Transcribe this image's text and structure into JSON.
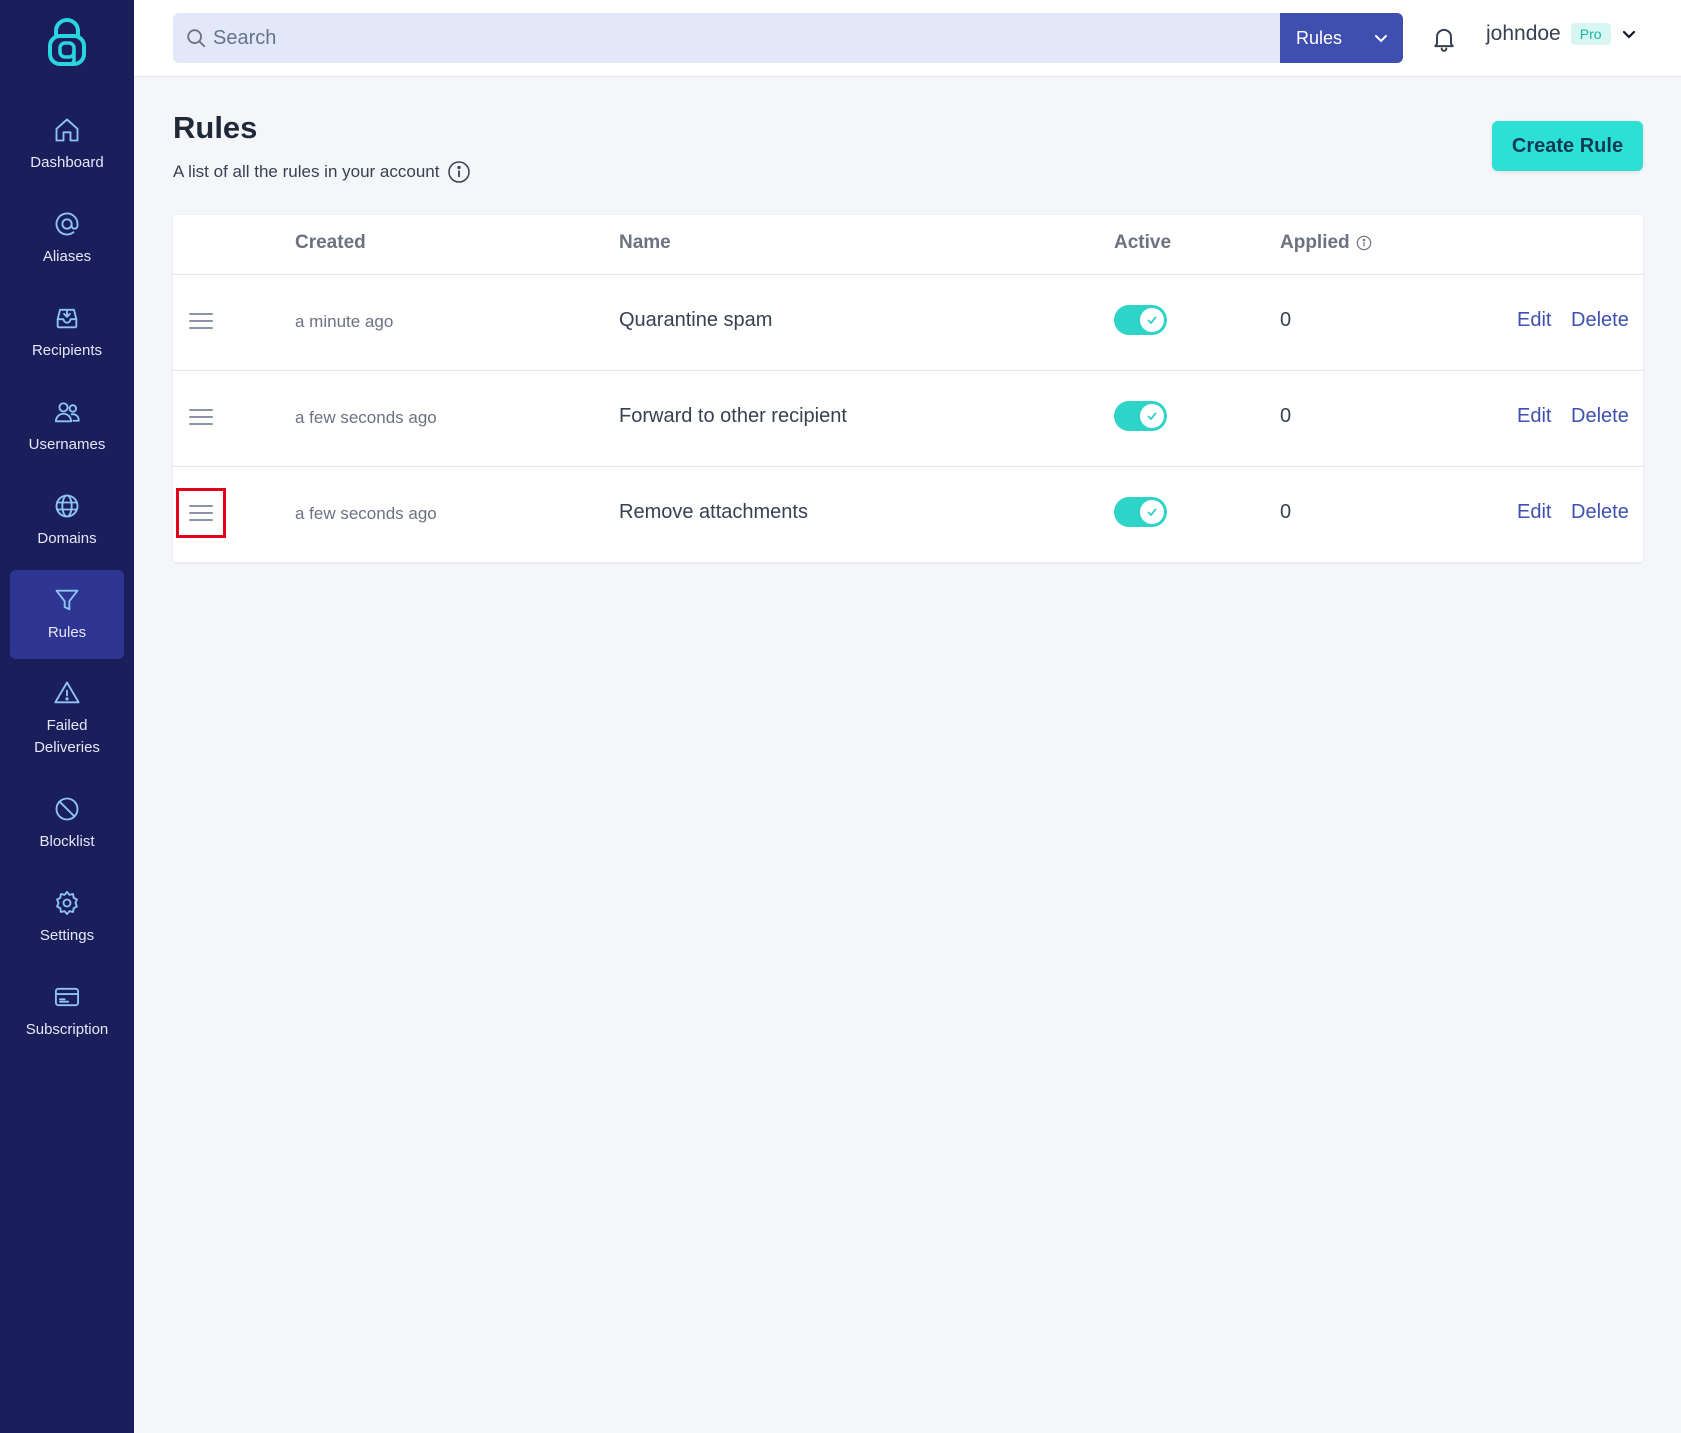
{
  "sidebar": {
    "items": [
      {
        "label": "Dashboard",
        "icon": "home-icon"
      },
      {
        "label": "Aliases",
        "icon": "at-icon"
      },
      {
        "label": "Recipients",
        "icon": "inbox-icon"
      },
      {
        "label": "Usernames",
        "icon": "users-icon"
      },
      {
        "label": "Domains",
        "icon": "globe-icon"
      },
      {
        "label": "Rules",
        "icon": "filter-icon",
        "active": true
      },
      {
        "label": "Failed\nDeliveries",
        "icon": "warning-icon"
      },
      {
        "label": "Blocklist",
        "icon": "ban-icon"
      },
      {
        "label": "Settings",
        "icon": "gear-icon"
      },
      {
        "label": "Subscription",
        "icon": "credit-card-icon"
      }
    ]
  },
  "topbar": {
    "search_placeholder": "Search",
    "search_scope": "Rules",
    "username": "johndoe",
    "plan_badge": "Pro"
  },
  "page": {
    "title": "Rules",
    "subtitle": "A list of all the rules in your account",
    "create_button": "Create Rule"
  },
  "table": {
    "headers": {
      "created": "Created",
      "name": "Name",
      "active": "Active",
      "applied": "Applied"
    },
    "rows": [
      {
        "created": "a minute ago",
        "name": "Quarantine spam",
        "active": true,
        "applied": "0",
        "edit": "Edit",
        "delete": "Delete"
      },
      {
        "created": "a few seconds ago",
        "name": "Forward to other recipient",
        "active": true,
        "applied": "0",
        "edit": "Edit",
        "delete": "Delete"
      },
      {
        "created": "a few seconds ago",
        "name": "Remove attachments",
        "active": true,
        "applied": "0",
        "edit": "Edit",
        "delete": "Delete"
      }
    ]
  },
  "colors": {
    "sidebar_bg": "#1a1f5c",
    "sidebar_active": "#2e3592",
    "accent": "#2de0d6",
    "link": "#3f4fb0",
    "highlight_box": "#e3001b"
  }
}
